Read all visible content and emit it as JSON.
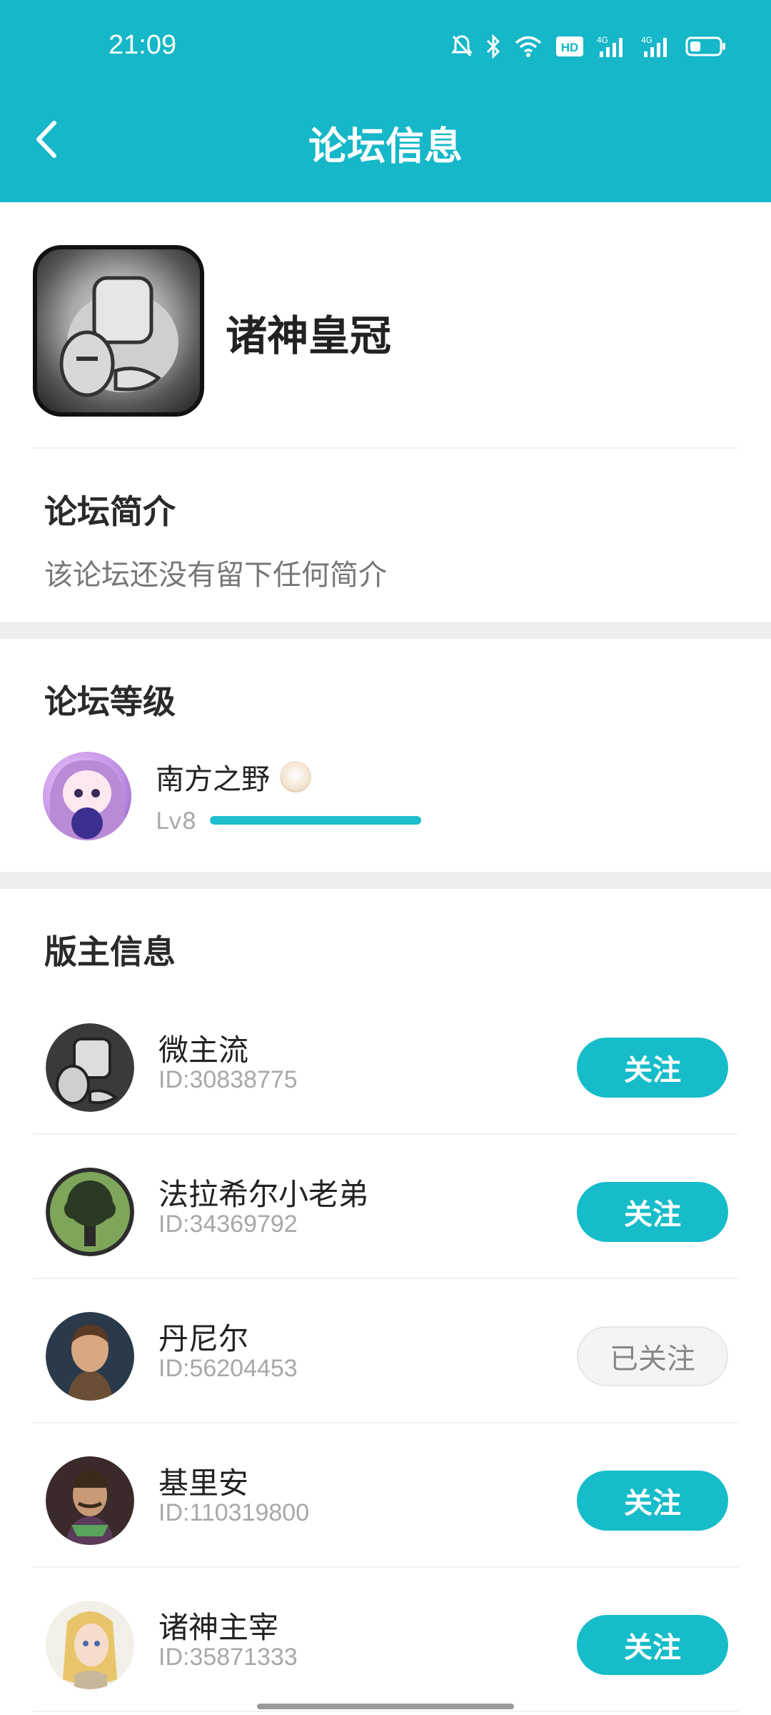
{
  "status_bar": {
    "time": "21:09",
    "icons": [
      "bell-off-icon",
      "bluetooth-icon",
      "wifi-icon",
      "hd-icon",
      "signal-4g-icon",
      "signal-4g-icon",
      "battery-icon"
    ]
  },
  "header": {
    "title": "论坛信息",
    "back_icon": "chevron-left-icon"
  },
  "forum": {
    "name": "诸神皇冠"
  },
  "intro": {
    "title": "论坛简介",
    "text": "该论坛还没有留下任何简介"
  },
  "level": {
    "title": "论坛等级",
    "user_name": "南方之野",
    "level_label": "Lv8",
    "progress": 1.0
  },
  "moderators": {
    "title": "版主信息",
    "items": [
      {
        "name": "微主流",
        "id": "ID:30838775",
        "button": "关注",
        "followed": false
      },
      {
        "name": "法拉希尔小老弟",
        "id": "ID:34369792",
        "button": "关注",
        "followed": false
      },
      {
        "name": "丹尼尔",
        "id": "ID:56204453",
        "button": "已关注",
        "followed": true
      },
      {
        "name": "基里安",
        "id": "ID:110319800",
        "button": "关注",
        "followed": false
      },
      {
        "name": "诸神主宰",
        "id": "ID:35871333",
        "button": "关注",
        "followed": false
      }
    ]
  },
  "colors": {
    "accent": "#16bcc9",
    "header": "#15b7c8"
  }
}
